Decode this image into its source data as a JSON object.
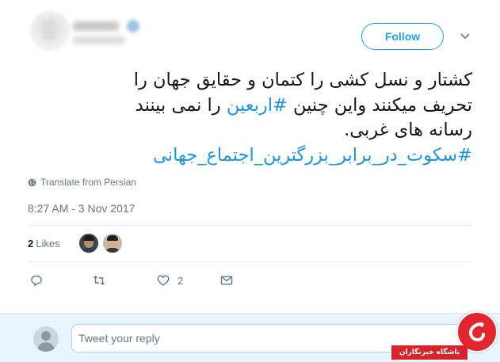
{
  "header": {
    "follow_label": "Follow"
  },
  "tweet": {
    "lines": [
      {
        "text": "کشتار و نسل کشی را کتمان و حقایق جهان را"
      },
      {
        "pre": "تحریف میکنند واین چنین ",
        "hashtag": "#اربعین",
        "post": " را نمی بینند"
      },
      {
        "text": "رسانه های غربی."
      },
      {
        "hashtag": "#سکوت_در_برابر_بزرگترین_اجتماع_جهانی"
      }
    ],
    "translate_label": "Translate from Persian",
    "timestamp": "8:27 AM - 3 Nov 2017",
    "likes_count": "2",
    "likes_label": "Likes",
    "like_action_count": "2"
  },
  "reply": {
    "placeholder": "Tweet your reply"
  },
  "watermark": {
    "text": "باشگاه خبرنگاران"
  },
  "colors": {
    "accent": "#1da1f2",
    "hashtag": "#1b95e0",
    "muted": "#657786",
    "reply_bar_bg": "#e8f5fd",
    "watermark_red": "#e3262d"
  },
  "icons": [
    "globe-icon",
    "reply-icon",
    "retweet-icon",
    "heart-icon",
    "envelope-icon",
    "chevron-down-icon"
  ]
}
